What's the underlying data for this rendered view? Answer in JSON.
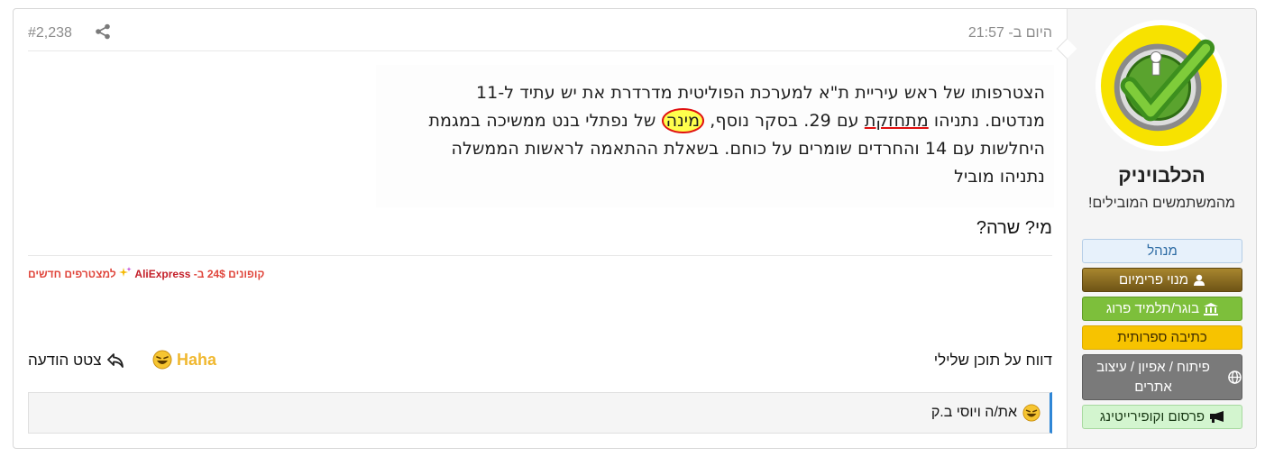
{
  "post": {
    "time": "היום ב- 21:57",
    "number": "#2,238",
    "share_icon": "share-icon",
    "quoted_image_lines": [
      "הצטרפותו של ראש עיריית ת\"א למערכת הפוליטית מדרדרת את יש עתיד ל-11",
      "נפתלי בנט ממשיכה במגמת",
      "היחלשות עם 14 והחרדים שומרים על כוחם. בשאלת ההתאמה לראשות הממשלה",
      "נתניהו מוביל"
    ],
    "line2_parts": {
      "before": "מנדטים. נתניהו ",
      "underlined": "מתחזקת",
      "middle": " עם 29. בסקר נוסף, ",
      "circled": "מינה",
      "after": " של "
    },
    "message": "מי? שרה?",
    "signature_ad": {
      "part1": "קופונים 24$ ב-",
      "part2": "AliExpress",
      "part3": "למצטרפים חדשים",
      "sparkle_icon": "sparkle-icon"
    },
    "footer": {
      "report": "דווח על תוכן שלילי",
      "reaction_label": "Haha",
      "reply": "צטט הודעה",
      "reply_icon": "reply-icon"
    },
    "reactions_bar": {
      "text": "את/ה ויוסי ב.ק",
      "emoji_icon": "laughing-emoji-icon"
    }
  },
  "user": {
    "name": "הכלבויניק",
    "title": "מהמשתמשים המובילים!",
    "banners": [
      {
        "label": "מנהל",
        "icon": ""
      },
      {
        "label": "מנוי פרימיום",
        "icon": "user-icon"
      },
      {
        "label": "בוגר/תלמיד פרוג",
        "icon": "university-icon"
      },
      {
        "label": "כתיבה ספרותית",
        "icon": ""
      },
      {
        "label": "פיתוח / אפיון / עיצוב אתרים",
        "icon": "globe-icon"
      },
      {
        "label": "פרסום וקופירייטינג",
        "icon": "megaphone-icon"
      }
    ],
    "accent": "#f7e200"
  }
}
